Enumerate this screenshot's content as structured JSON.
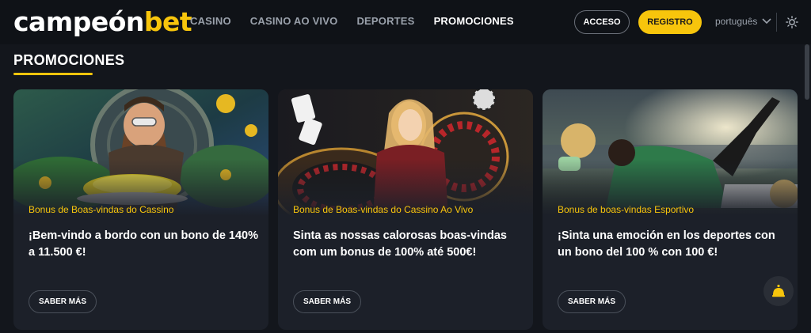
{
  "header": {
    "logo_part1": "campeón",
    "logo_part2": "bet",
    "nav": [
      "CASINO",
      "CASINO AO VIVO",
      "DEPORTES",
      "PROMOCIONES"
    ],
    "acceso_label": "ACCESO",
    "registro_label": "REGISTRO",
    "language": "português"
  },
  "page": {
    "title": "PROMOCIONES"
  },
  "cards": [
    {
      "category": "Bonus de Boas-vindas do Cassino",
      "title": "¡Bem-vindo a bordo con un bono de 140% a 11.500 €!",
      "button": "SABER MÁS"
    },
    {
      "category": "Bonus de Boas-vindas do Cassino Ao Vivo",
      "title": "Sinta as nossas calorosas boas-vindas com um bonus de 100% até 500€!",
      "button": "SABER MÁS"
    },
    {
      "category": "Bonus de boas-vindas Esportivo",
      "title": "¡Sinta una emoción en los deportes con un bono del 100 % con 100 €!",
      "button": "SABER MÁS"
    }
  ],
  "colors": {
    "accent": "#f7c50c",
    "background": "#13161c",
    "card": "#1c2029"
  },
  "icons": [
    "chevron-down-icon",
    "sun-icon",
    "bell-icon"
  ]
}
